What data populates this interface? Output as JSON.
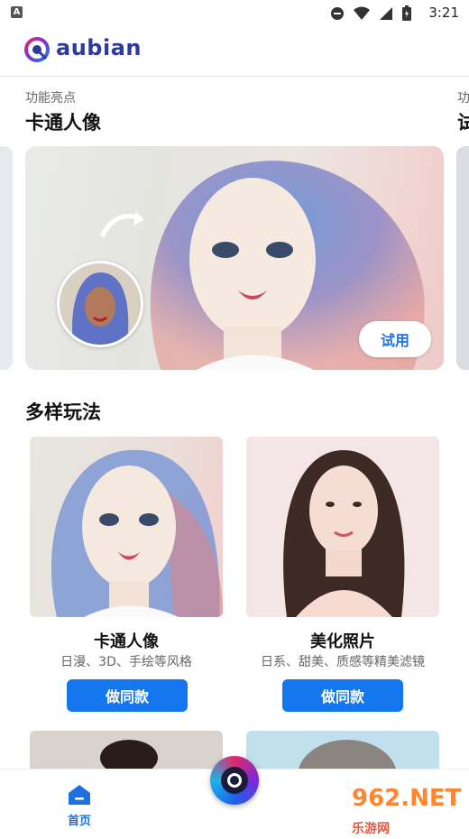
{
  "status_bar": {
    "time": "3:21",
    "badge": "A"
  },
  "header": {
    "brand": "aubian"
  },
  "highlights": {
    "subtitle": "功能亮点",
    "title": "卡通人像",
    "next_subtitle": "功",
    "next_title": "试",
    "try_label": "试用"
  },
  "section": {
    "title": "多样玩法"
  },
  "cards": [
    {
      "title": "卡通人像",
      "desc": "日漫、3D、手绘等风格",
      "button": "做同款"
    },
    {
      "title": "美化照片",
      "desc": "日系、甜美、质感等精美滤镜",
      "button": "做同款"
    }
  ],
  "bottom_nav": {
    "home_label": "首页"
  },
  "watermark": {
    "text": "962.NET",
    "sub": "乐游网"
  },
  "colors": {
    "brand": "#2e3a9e",
    "accent": "#1477f0",
    "active_nav": "#1e6fe0"
  }
}
